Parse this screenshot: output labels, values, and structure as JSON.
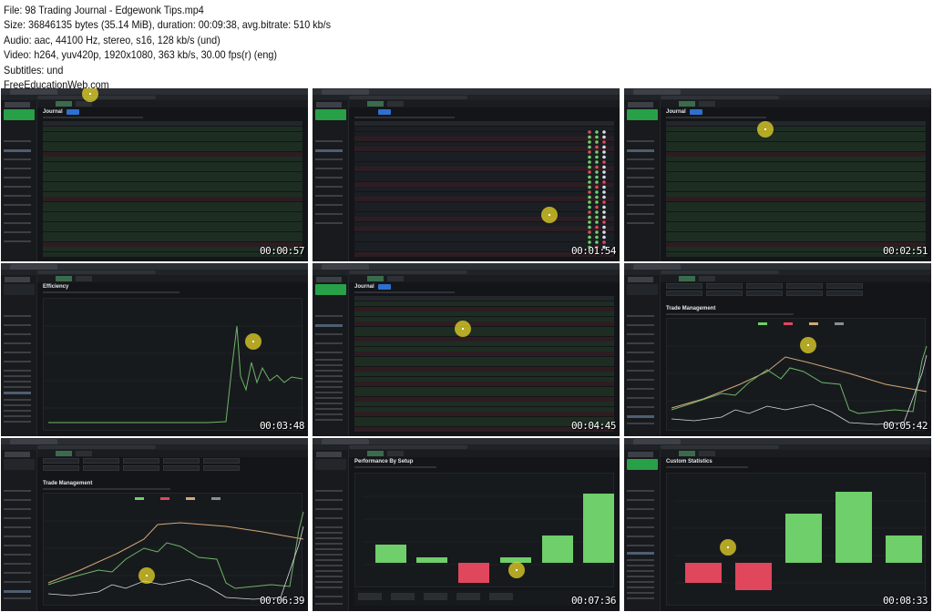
{
  "header": {
    "file": "File: 98 Trading Journal - Edgewonk Tips.mp4",
    "size": "Size: 36846135 bytes (35.14 MiB), duration: 00:09:38, avg.bitrate: 510 kb/s",
    "audio": "Audio: aac, 44100 Hz, stereo, s16, 128 kb/s (und)",
    "video": "Video: h264, yuv420p, 1920x1080, 363 kb/s, 30.00 fps(r) (eng)",
    "subtitles": "Subtitles: und",
    "site": "FreeEducationWeb.com"
  },
  "thumbnails": [
    {
      "timestamp": "00:00:57",
      "title": "Journal",
      "view": "table-green"
    },
    {
      "timestamp": "00:01:54",
      "title": "",
      "view": "table-wide"
    },
    {
      "timestamp": "00:02:51",
      "title": "Journal",
      "view": "table-green"
    },
    {
      "timestamp": "00:03:48",
      "title": "Efficiency",
      "view": "line-chart"
    },
    {
      "timestamp": "00:04:45",
      "title": "Journal",
      "view": "table-mixed"
    },
    {
      "timestamp": "00:05:42",
      "title": "Trade Management",
      "view": "multi-line"
    },
    {
      "timestamp": "00:06:39",
      "title": "Trade Management",
      "view": "multi-line"
    },
    {
      "timestamp": "00:07:36",
      "title": "Performance By Setup",
      "view": "bar-chart"
    },
    {
      "timestamp": "00:08:33",
      "title": "Custom Statistics",
      "view": "bar-chart"
    }
  ],
  "colors": {
    "app_bg": "#131518",
    "sidebar_bg": "#181a1d",
    "balance_green": "#27a047",
    "accent_blue": "#2f6fd1",
    "bar_green": "#6fcf6a",
    "bar_red": "#e0475d",
    "line_green": "#6fb56a",
    "line_tan": "#d2a877",
    "cursor": "#f0dc28"
  },
  "icons": {
    "cursor_highlight": "click-highlight-icon"
  }
}
